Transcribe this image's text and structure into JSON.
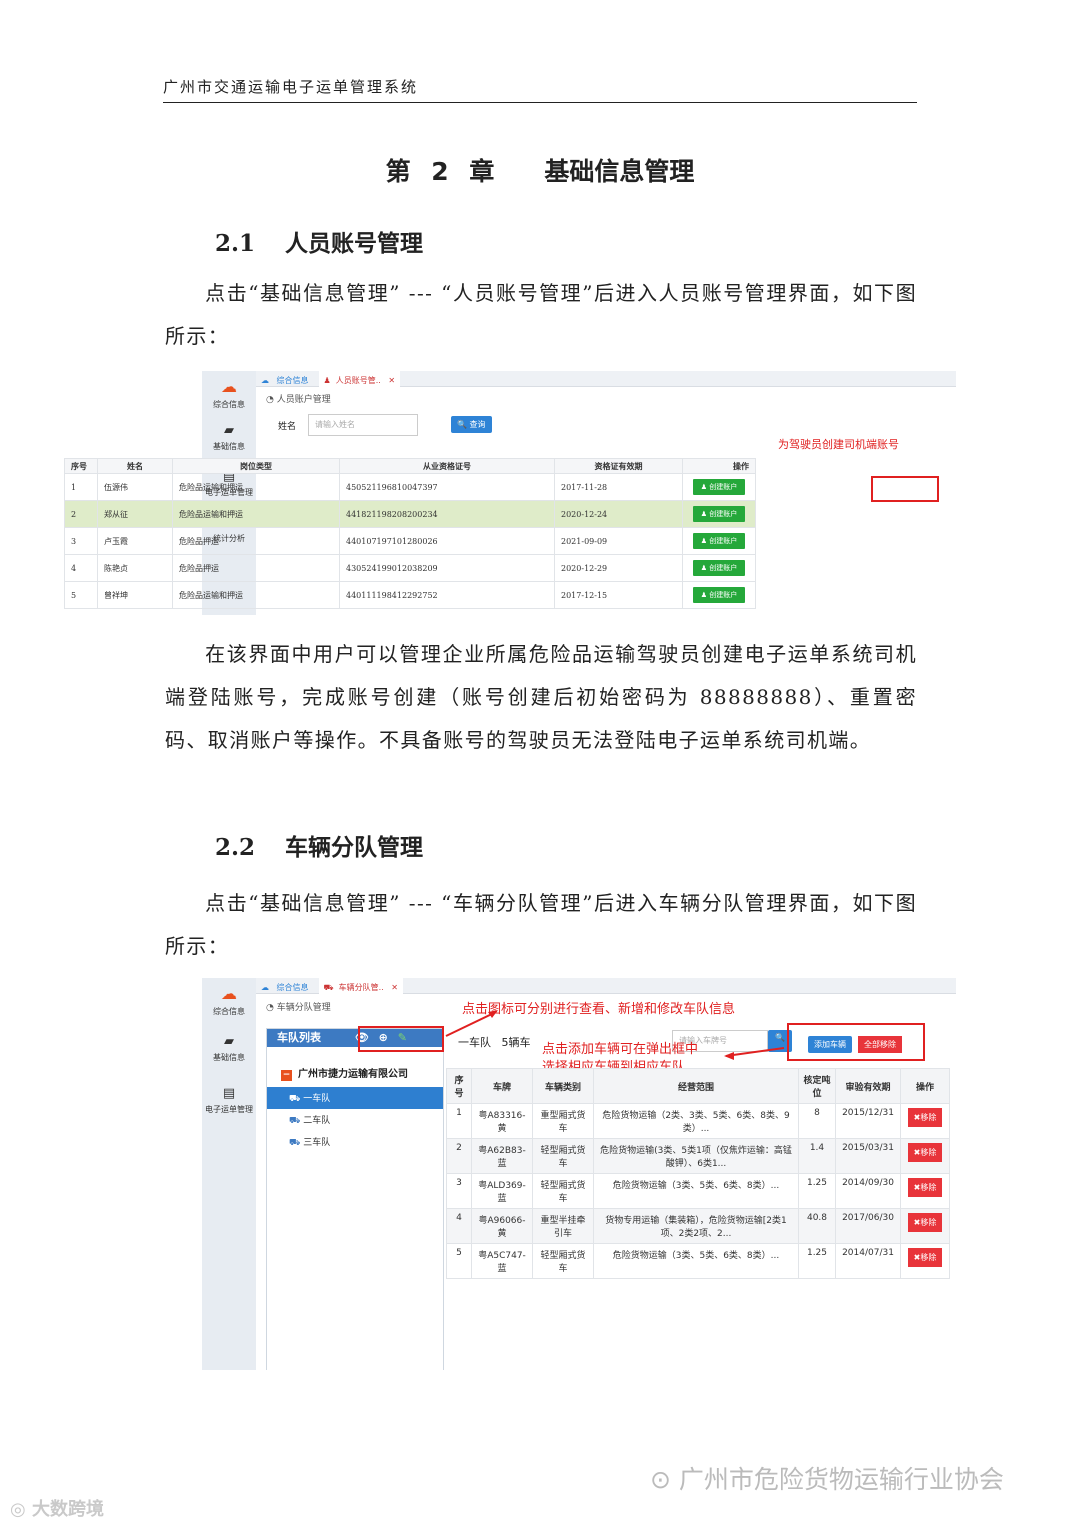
{
  "header": "广州市交通运输电子运单管理系统",
  "chapter": {
    "num": "第 2 章",
    "title": "基础信息管理"
  },
  "sec1": {
    "num": "2.1",
    "title": "人员账号管理"
  },
  "p1": "点击“基础信息管理” --- “人员账号管理”后进入人员账号管理界面，如下图所示：",
  "p2": "在该界面中用户可以管理企业所属危险品运输驾驶员创建电子运单系统司机端登陆账号，完成账号创建（账号创建后初始密码为 88888888）、重置密码、取消账户等操作。不具备账号的驾驶员无法登陆电子运单系统司机端。",
  "sec2": {
    "num": "2.2",
    "title": "车辆分队管理"
  },
  "p3": "点击“基础信息管理” --- “车辆分队管理”后进入车辆分队管理界面，如下图所示：",
  "shot1": {
    "side": [
      "综合信息",
      "基础信息",
      "电子运单管理",
      "统计分析"
    ],
    "tabs": [
      "综合信息",
      "人员账号管.."
    ],
    "crumb": "人员账户管理",
    "name_label": "姓名",
    "name_placeholder": "请输入姓名",
    "query": "查询",
    "annotation": "为驾驶员创建司机端账号",
    "columns": [
      "序号",
      "姓名",
      "岗位类型",
      "从业资格证号",
      "资格证有效期",
      "操作"
    ],
    "rows": [
      [
        "1",
        "伍源伟",
        "危险品运输和押运",
        "450521196810047397",
        "2017-11-28"
      ],
      [
        "2",
        "郑从征",
        "危险品运输和押运",
        "441821198208200234",
        "2020-12-24"
      ],
      [
        "3",
        "卢玉霞",
        "危险品押运",
        "440107197101280026",
        "2021-09-09"
      ],
      [
        "4",
        "陈艳贞",
        "危险品押运",
        "430524199012038209",
        "2020-12-29"
      ],
      [
        "5",
        "曾祥坤",
        "危险品运输和押运",
        "440111198412292752",
        "2017-12-15"
      ]
    ],
    "btn": "创建账户"
  },
  "shot2": {
    "side": [
      "综合信息",
      "基础信息",
      "电子运单管理"
    ],
    "tabs": [
      "综合信息",
      "车辆分队管.."
    ],
    "crumb": "车辆分队管理",
    "panel_title": "车队列表",
    "company": "广州市捷力运输有限公司",
    "teams": [
      "一车队",
      "二车队",
      "三车队"
    ],
    "current": "一车队",
    "count": "5辆车",
    "search_placeholder": "请输入车牌号",
    "add": "添加车辆",
    "remove_all": "全部移除",
    "annot1": "点击图标可分别进行查看、新增和修改车队信息",
    "annot2a": "点击添加车辆可在弹出框中",
    "annot2b": "选择相应车辆到相应车队",
    "columns": [
      "序号",
      "车牌",
      "车辆类别",
      "经营范围",
      "核定吨位",
      "审验有效期",
      "操作"
    ],
    "rows": [
      [
        "1",
        "粤A83316-黄",
        "重型厢式货车",
        "危险货物运输（2类、3类、5类、6类、8类、9类）...",
        "8",
        "2015/12/31"
      ],
      [
        "2",
        "粤A62B83-蓝",
        "轻型厢式货车",
        "危险货物运输(3类、5类1项（仅焦炸运输：高锰酸钾）、6类1...",
        "1.4",
        "2015/03/31"
      ],
      [
        "3",
        "粤ALD369-蓝",
        "轻型厢式货车",
        "危险货物运输（3类、5类、6类、8类）...",
        "1.25",
        "2014/09/30"
      ],
      [
        "4",
        "粤A96066-黄",
        "重型半挂牵引车",
        "货物专用运输（集装箱），危险货物运输[2类1项、2类2项、2...",
        "40.8",
        "2017/06/30"
      ],
      [
        "5",
        "粤A5C747-蓝",
        "轻型厢式货车",
        "危险货物运输（3类、5类、6类、8类）...",
        "1.25",
        "2014/07/31"
      ]
    ],
    "remove": "移除"
  },
  "footer": "广州市危险货物运输行业协会",
  "watermark": "大数跨境"
}
